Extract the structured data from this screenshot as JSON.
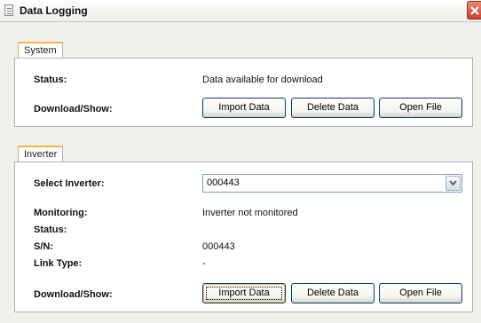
{
  "window": {
    "title": "Data Logging"
  },
  "system": {
    "tab_label": "System",
    "status_label": "Status:",
    "status_value": "Data available for download",
    "download_label": "Download/Show:",
    "buttons": {
      "import": "Import Data",
      "delete": "Delete Data",
      "open": "Open File"
    }
  },
  "inverter": {
    "tab_label": "Inverter",
    "select_label": "Select Inverter:",
    "selected_inverter": "000443",
    "monitoring_label": "Monitoring:",
    "monitoring_value": "Inverter not monitored",
    "status_label": "Status:",
    "status_value": "",
    "sn_label": "S/N:",
    "sn_value": "000443",
    "link_type_label": "Link Type:",
    "link_type_value": "-",
    "download_label": "Download/Show:",
    "buttons": {
      "import": "Import Data",
      "delete": "Delete Data",
      "open": "Open File"
    }
  }
}
